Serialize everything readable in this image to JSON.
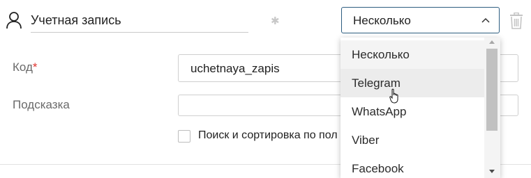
{
  "field": {
    "name": "Учетная запись",
    "icon": "user-icon",
    "required_marker": "✱"
  },
  "type_select": {
    "value": "Несколько",
    "icon": "chevron-up-icon"
  },
  "delete_icon": "trash-icon",
  "form": {
    "code_label": "Код",
    "code_required": "*",
    "code_value": "uchetnaya_zapis",
    "hint_label": "Подсказка",
    "hint_value": "",
    "search_sort_label": "Поиск и сортировка по пол"
  },
  "dropdown": {
    "options": [
      {
        "label": "Несколько"
      },
      {
        "label": "Telegram"
      },
      {
        "label": "WhatsApp"
      },
      {
        "label": "Viber"
      },
      {
        "label": "Facebook"
      }
    ],
    "selected": "Несколько",
    "hovered": "Telegram"
  },
  "colors": {
    "focus_border": "#2c5d80",
    "required": "#e0342f",
    "hover_bg": "#ececec"
  }
}
